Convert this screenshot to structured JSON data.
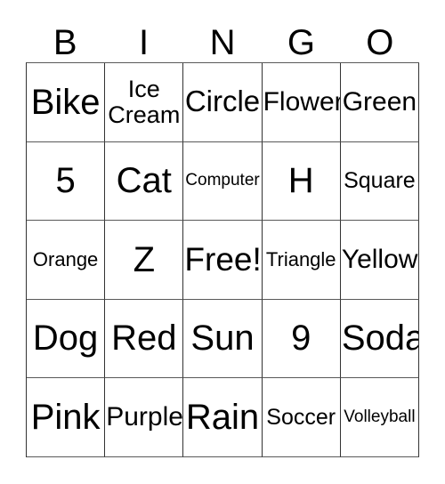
{
  "card": {
    "title_letters": [
      "B",
      "I",
      "N",
      "G",
      "O"
    ],
    "free_space_label": "Free!",
    "colors": {
      "text": "#000000",
      "cell_background": "#ffffff",
      "grid_line_vertical": "#333333",
      "grid_line_horizontal": "#595959",
      "page_background": "#ffffff"
    },
    "columns": 5,
    "rows": 5,
    "grid": [
      [
        {
          "text": "Bike",
          "size": "sz-xxl"
        },
        {
          "text": "Ice\nCream",
          "size": "sz-s"
        },
        {
          "text": "Circle",
          "size": "sz-l"
        },
        {
          "text": "Flower",
          "size": "sz-m"
        },
        {
          "text": "Green",
          "size": "sz-m"
        }
      ],
      [
        {
          "text": "5",
          "size": "sz-xxl"
        },
        {
          "text": "Cat",
          "size": "sz-xxl"
        },
        {
          "text": "Computer",
          "size": "sz-tn"
        },
        {
          "text": "H",
          "size": "sz-xxl"
        },
        {
          "text": "Square",
          "size": "sz-xs"
        }
      ],
      [
        {
          "text": "Orange",
          "size": "sz-xxs"
        },
        {
          "text": "Z",
          "size": "sz-xxl"
        },
        {
          "text": "Free!",
          "size": "sz-xl"
        },
        {
          "text": "Triangle",
          "size": "sz-xxs"
        },
        {
          "text": "Yellow",
          "size": "sz-m"
        }
      ],
      [
        {
          "text": "Dog",
          "size": "sz-xxl"
        },
        {
          "text": "Red",
          "size": "sz-xxl"
        },
        {
          "text": "Sun",
          "size": "sz-xxl"
        },
        {
          "text": "9",
          "size": "sz-xxl"
        },
        {
          "text": "Soda",
          "size": "sz-xxl"
        }
      ],
      [
        {
          "text": "Pink",
          "size": "sz-xxl"
        },
        {
          "text": "Purple",
          "size": "sz-m"
        },
        {
          "text": "Rain",
          "size": "sz-xxl"
        },
        {
          "text": "Soccer",
          "size": "sz-xs"
        },
        {
          "text": "Volleyball",
          "size": "sz-tn"
        }
      ]
    ]
  }
}
